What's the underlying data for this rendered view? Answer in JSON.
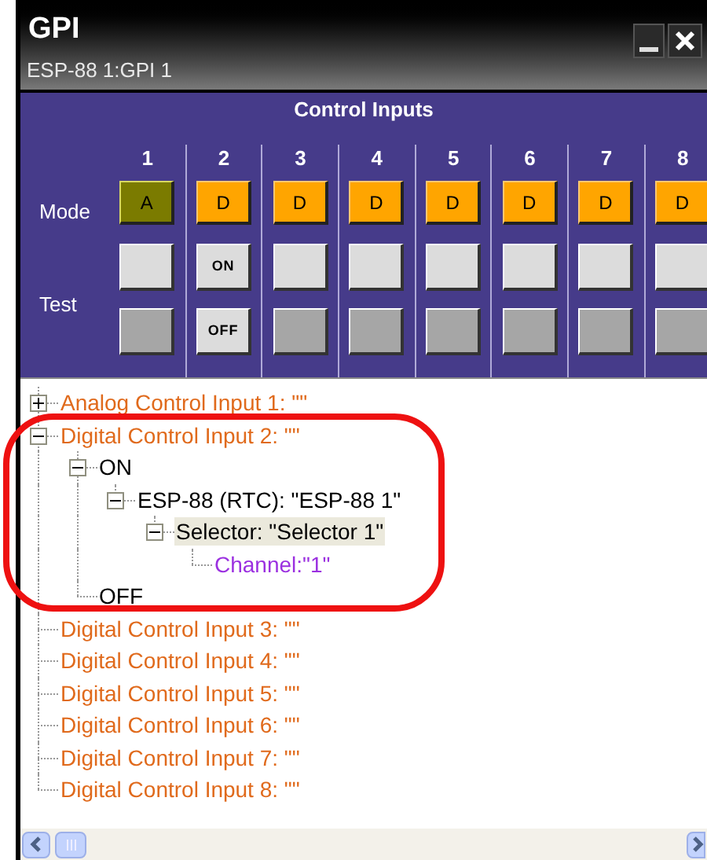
{
  "window": {
    "title": "GPI",
    "subtitle": "ESP-88 1:GPI 1"
  },
  "panel": {
    "title": "Control Inputs",
    "mode_label": "Mode",
    "test_label": "Test",
    "columns": [
      {
        "number": "1",
        "kind": "analog",
        "mode": "A",
        "test_enabled": false
      },
      {
        "number": "2",
        "kind": "digital",
        "mode": "D",
        "test_enabled": true,
        "on_label": "ON",
        "off_label": "OFF"
      },
      {
        "number": "3",
        "kind": "digital",
        "mode": "D",
        "test_enabled": false
      },
      {
        "number": "4",
        "kind": "digital",
        "mode": "D",
        "test_enabled": false
      },
      {
        "number": "5",
        "kind": "digital",
        "mode": "D",
        "test_enabled": false
      },
      {
        "number": "6",
        "kind": "digital",
        "mode": "D",
        "test_enabled": false
      },
      {
        "number": "7",
        "kind": "digital",
        "mode": "D",
        "test_enabled": false
      },
      {
        "number": "8",
        "kind": "digital",
        "mode": "D",
        "test_enabled": false
      }
    ]
  },
  "tree": [
    {
      "label": "Analog Control Input 1: \"\"",
      "color": "#e06a1c",
      "expanded": false,
      "selected": false,
      "has_children": true
    },
    {
      "label": "Digital Control Input 2: \"\"",
      "color": "#e06a1c",
      "expanded": true,
      "selected": false,
      "children": [
        {
          "label": "ON",
          "color": "#000000",
          "expanded": true,
          "selected": false,
          "children": [
            {
              "label": "ESP-88 (RTC): \"ESP-88 1\"",
              "color": "#000000",
              "expanded": true,
              "selected": false,
              "children": [
                {
                  "label": "Selector: \"Selector 1\"",
                  "color": "#000000",
                  "expanded": true,
                  "selected": true,
                  "children": [
                    {
                      "label": "Channel:\"1\"",
                      "color": "#9b30e0",
                      "selected": false
                    }
                  ]
                }
              ]
            }
          ]
        },
        {
          "label": "OFF",
          "color": "#000000",
          "selected": false
        }
      ]
    },
    {
      "label": "Digital Control Input 3: \"\"",
      "color": "#e06a1c",
      "selected": false
    },
    {
      "label": "Digital Control Input 4: \"\"",
      "color": "#e06a1c",
      "selected": false
    },
    {
      "label": "Digital Control Input 5: \"\"",
      "color": "#e06a1c",
      "selected": false
    },
    {
      "label": "Digital Control Input 6: \"\"",
      "color": "#e06a1c",
      "selected": false
    },
    {
      "label": "Digital Control Input 7: \"\"",
      "color": "#e06a1c",
      "selected": false
    },
    {
      "label": "Digital Control Input 8: \"\"",
      "color": "#e06a1c",
      "selected": false
    }
  ]
}
